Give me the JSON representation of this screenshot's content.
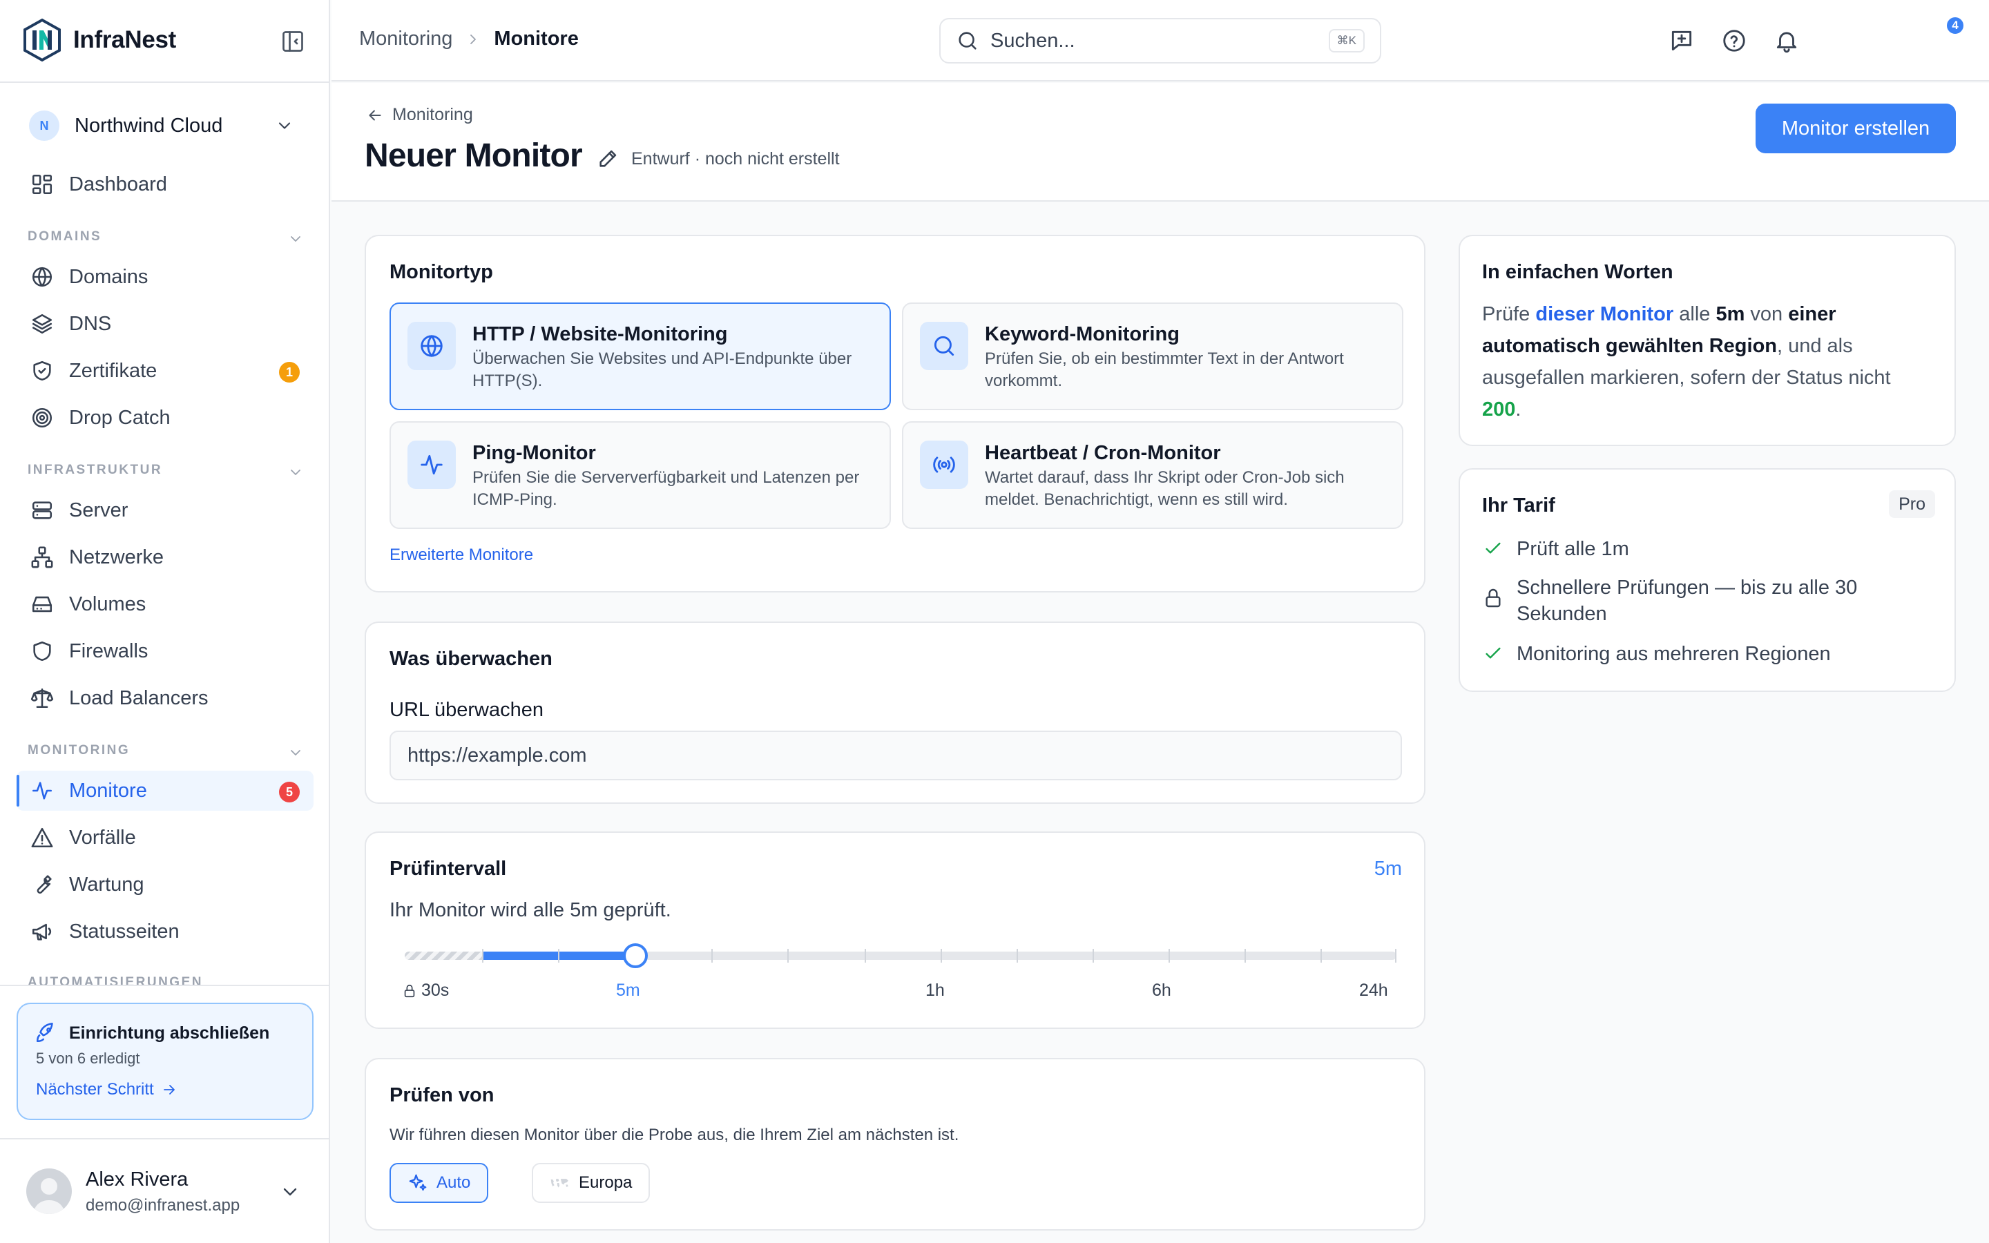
{
  "brand": {
    "name": "InfraNest"
  },
  "org": {
    "initial": "N",
    "name": "Northwind Cloud"
  },
  "nav": {
    "dashboard": "Dashboard",
    "sections": {
      "domains": "DOMAINS",
      "infra": "INFRASTRUKTUR",
      "monitoring": "MONITORING",
      "automation": "AUTOMATISIERUNGEN"
    },
    "domains": "Domains",
    "dns": "DNS",
    "certs": "Zertifikate",
    "certs_badge": "1",
    "dropcatch": "Drop Catch",
    "server": "Server",
    "networks": "Netzwerke",
    "volumes": "Volumes",
    "firewalls": "Firewalls",
    "lb": "Load Balancers",
    "monitors": "Monitore",
    "monitors_badge": "5",
    "incidents": "Vorfälle",
    "maintenance": "Wartung",
    "statuspages": "Statusseiten"
  },
  "setup": {
    "title": "Einrichtung abschließen",
    "progress": "5 von 6 erledigt",
    "next": "Nächster Schritt"
  },
  "user": {
    "name": "Alex Rivera",
    "email": "demo@infranest.app"
  },
  "topbar": {
    "crumb_parent": "Monitoring",
    "crumb_current": "Monitore",
    "search_placeholder": "Suchen...",
    "shortcut": "⌘K",
    "notifications": "4"
  },
  "page": {
    "back": "Monitoring",
    "title": "Neuer Monitor",
    "draft": "Entwurf · noch nicht erstellt",
    "create": "Monitor erstellen"
  },
  "monitor_type": {
    "title": "Monitortyp",
    "options": [
      {
        "title": "HTTP / Website-Monitoring",
        "desc": "Überwachen Sie Websites und API-Endpunkte über HTTP(S).",
        "icon": "globe-icon",
        "selected": true
      },
      {
        "title": "Keyword-Monitoring",
        "desc": "Prüfen Sie, ob ein bestimmter Text in der Antwort vorkommt.",
        "icon": "search-icon",
        "selected": false
      },
      {
        "title": "Ping-Monitor",
        "desc": "Prüfen Sie die Serververfügbarkeit und Latenzen per ICMP-Ping.",
        "icon": "pulse-icon",
        "selected": false
      },
      {
        "title": "Heartbeat / Cron-Monitor",
        "desc": "Wartet darauf, dass Ihr Skript oder Cron-Job sich meldet. Benachrichtigt, wenn es still wird.",
        "icon": "broadcast-icon",
        "selected": false
      }
    ],
    "advanced": "Erweiterte Monitore"
  },
  "what": {
    "title": "Was überwachen",
    "url_label": "URL überwachen",
    "url_placeholder": "https://example.com"
  },
  "interval": {
    "title": "Prüfintervall",
    "value": "5m",
    "desc": "Ihr Monitor wird alle 5m geprüft.",
    "labels": {
      "min": "30s",
      "current": "5m",
      "h1": "1h",
      "h6": "6h",
      "h24": "24h"
    }
  },
  "from": {
    "title": "Prüfen von",
    "desc": "Wir führen diesen Monitor über die Probe aus, die Ihrem Ziel am nächsten ist.",
    "auto": "Auto",
    "europe": "Europa"
  },
  "plain": {
    "title": "In einfachen Worten",
    "t1": "Prüfe ",
    "link": "dieser Monitor",
    "t2": " alle ",
    "interval": "5m",
    "t3": " von ",
    "region": "einer automatisch gewählten Region",
    "t4": ", und als ausgefallen markieren, sofern der Status nicht ",
    "status": "200",
    "t5": "."
  },
  "plan": {
    "title": "Ihr Tarif",
    "badge": "Pro",
    "f1": "Prüft alle 1m",
    "f2": "Schnellere Prüfungen — bis zu alle 30 Sekunden",
    "f3": "Monitoring aus mehreren Regionen"
  },
  "colors": {
    "accent": "#3b82f6",
    "badge_orange": "#f59e0b",
    "badge_red": "#ef4444",
    "success": "#16a34a"
  }
}
